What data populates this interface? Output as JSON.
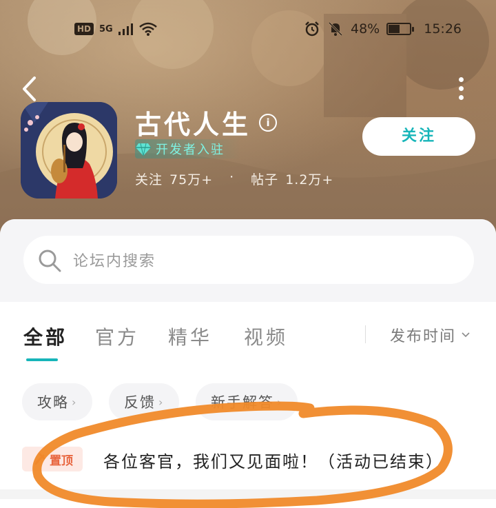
{
  "status_bar": {
    "hd_label": "HD",
    "network_label": "5G",
    "battery_level": "48%",
    "battery_fill_fraction": 0.48,
    "time": "15:26"
  },
  "header": {
    "app_name": "古代人生",
    "developer_badge": "开发者入驻",
    "stats": {
      "follow_label": "关注",
      "follow_count": "75万+",
      "separator": "·",
      "posts_label": "帖子",
      "posts_count": "1.2万+"
    },
    "follow_button": "关注"
  },
  "search": {
    "placeholder": "论坛内搜索"
  },
  "tabs": [
    {
      "label": "全部",
      "active": true
    },
    {
      "label": "官方",
      "active": false
    },
    {
      "label": "精华",
      "active": false
    },
    {
      "label": "视频",
      "active": false
    }
  ],
  "sort": {
    "label": "发布时间"
  },
  "chips": [
    {
      "label": "攻略"
    },
    {
      "label": "反馈"
    },
    {
      "label": "新手解答"
    }
  ],
  "pinned_post": {
    "badge": "置顶",
    "title": "各位客官，我们又见面啦！（活动已结束）"
  },
  "colors": {
    "accent": "#17b5b9",
    "pin": "#e8663f",
    "scribble": "#f08a2a"
  },
  "icons": {
    "back": "chevron-left-icon",
    "more": "more-vertical-icon",
    "info": "info-icon",
    "developer": "diamond-icon",
    "search": "search-icon",
    "sort": "chevron-down-icon",
    "pin": "pin-icon"
  }
}
